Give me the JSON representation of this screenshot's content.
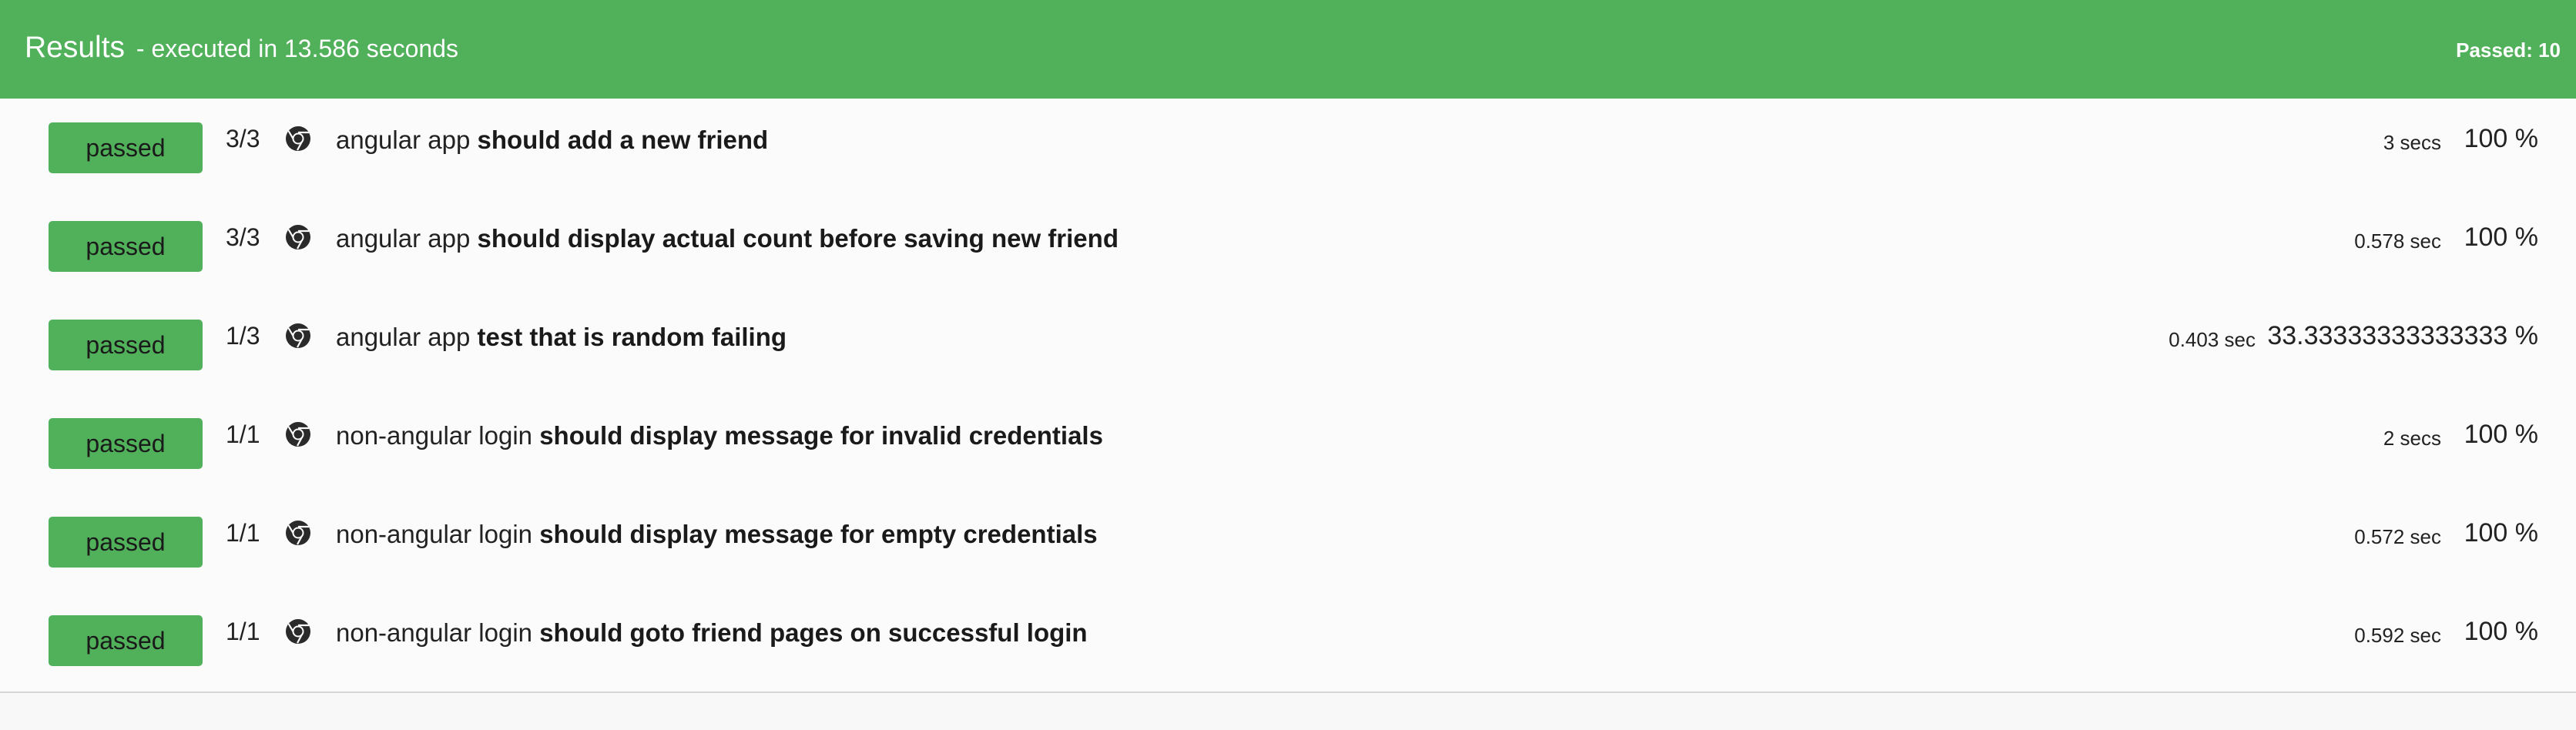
{
  "header": {
    "title": "Results",
    "subtitle": "- executed in 13.586 seconds",
    "passed_summary": "Passed: 10"
  },
  "colors": {
    "header_bg": "#51b05a",
    "badge_bg": "#51b05a",
    "page_bg": "#f8f8f8"
  },
  "rows": [
    {
      "status": "passed",
      "ratio": "3/3",
      "browser_icon": "chrome-icon",
      "suite": "angular app",
      "spec": "should add a new friend",
      "duration": "3 secs",
      "percent": "100 %"
    },
    {
      "status": "passed",
      "ratio": "3/3",
      "browser_icon": "chrome-icon",
      "suite": "angular app",
      "spec": "should display actual count before saving new friend",
      "duration": "0.578 sec",
      "percent": "100 %"
    },
    {
      "status": "passed",
      "ratio": "1/3",
      "browser_icon": "chrome-icon",
      "suite": "angular app",
      "spec": "test that is random failing",
      "duration": "0.403 sec",
      "percent": "33.33333333333333 %"
    },
    {
      "status": "passed",
      "ratio": "1/1",
      "browser_icon": "chrome-icon",
      "suite": "non-angular login",
      "spec": "should display message for invalid credentials",
      "duration": "2 secs",
      "percent": "100 %"
    },
    {
      "status": "passed",
      "ratio": "1/1",
      "browser_icon": "chrome-icon",
      "suite": "non-angular login",
      "spec": "should display message for empty credentials",
      "duration": "0.572 sec",
      "percent": "100 %"
    },
    {
      "status": "passed",
      "ratio": "1/1",
      "browser_icon": "chrome-icon",
      "suite": "non-angular login",
      "spec": "should goto friend pages on successful login",
      "duration": "0.592 sec",
      "percent": "100 %"
    }
  ]
}
